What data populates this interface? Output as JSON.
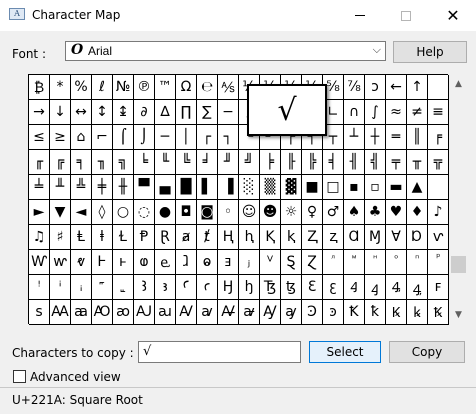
{
  "window": {
    "title": "Character Map",
    "app_icon_glyph": "A"
  },
  "font": {
    "label": "Font :",
    "selected": "Arial",
    "font_icon": "O",
    "help_label": "Help"
  },
  "grid_rows": [
    [
      "₿",
      "*",
      "%",
      "ℓ",
      "№",
      "℗",
      "™",
      "Ω",
      "℮",
      "⅍",
      "⅓",
      "⅓",
      "⅓",
      "⅓",
      "⅝",
      "⅞",
      "ↄ",
      "←",
      "↑",
      ""
    ],
    [
      "→",
      "↓",
      "↔",
      "↕",
      "↨",
      "∂",
      "∆",
      "∏",
      "∑",
      "−",
      "∕",
      "∙",
      "√",
      "∞",
      "∟",
      "∩",
      "∫",
      "≈",
      "≠",
      "≡"
    ],
    [
      "≤",
      "≥",
      "⌂",
      "⌐",
      "⌠",
      "⌡",
      "─",
      "│",
      "┌",
      "┐",
      "└",
      "┘",
      "├",
      "┤",
      "┬",
      "┴",
      "┼",
      "═",
      "║",
      "╒"
    ],
    [
      "╓",
      "╔",
      "╕",
      "╖",
      "╗",
      "╘",
      "╙",
      "╚",
      "╛",
      "╜",
      "╝",
      "╞",
      "╟",
      "╠",
      "╡",
      "╢",
      "╣",
      "╤",
      "╥",
      "╦"
    ],
    [
      "╧",
      "╨",
      "╩",
      "╪",
      "╫",
      "▀",
      "▄",
      "█",
      "▌",
      "▐",
      "░",
      "▒",
      "▓",
      "■",
      "□",
      "▪",
      "▫",
      "▬",
      "▲",
      ""
    ],
    [
      "►",
      "▼",
      "◄",
      "◊",
      "○",
      "◌",
      "●",
      "◘",
      "◙",
      "◦",
      "☺",
      "☻",
      "☼",
      "♀",
      "♂",
      "♠",
      "♣",
      "♥",
      "♦",
      "♪"
    ],
    [
      "♫",
      "♯",
      "Ⱡ",
      "ⱡ",
      "Ɫ",
      "Ᵽ",
      "Ɽ",
      "ⱥ",
      "ⱦ",
      "Ⱨ",
      "ⱨ",
      "Ⱪ",
      "ⱪ",
      "Ⱬ",
      "ⱬ",
      "Ɑ",
      "Ɱ",
      "Ɐ",
      "Ɒ",
      "ⱱ"
    ],
    [
      "Ⱳ",
      "ⱳ",
      "ⱴ",
      "Ⱶ",
      "ⱶ",
      "ⱷ",
      "ⱸ",
      "ⱹ",
      "ⱺ",
      "ⱻ",
      "ⱼ",
      "ⱽ",
      "Ȿ",
      "Ɀ",
      "ⷧ",
      "ⷨ",
      "ⷩ",
      "ⷪ",
      "ⷫ",
      "ⷬ"
    ],
    [
      "ꜝ",
      "ꜞ",
      "ꜟ",
      "꜠",
      "꜡",
      "Ꜣ",
      "ꜣ",
      "Ꜥ",
      "ꜥ",
      "Ꜧ",
      "ꜧ",
      "Ꜩ",
      "ꜩ",
      "Ꜫ",
      "ꜫ",
      "Ꜭ",
      "ꜭ",
      "Ꜯ",
      "ꜯ",
      "ꜰ"
    ],
    [
      "ꜱ",
      "Ꜳ",
      "ꜳ",
      "Ꜵ",
      "ꜵ",
      "Ꜷ",
      "ꜷ",
      "Ꜹ",
      "ꜹ",
      "Ꜻ",
      "ꜻ",
      "Ꜽ",
      "ꜽ",
      "Ꜿ",
      "ꜿ",
      "Ꝁ",
      "ꝁ",
      "Ꝃ",
      "ꝃ",
      "Ꝅ"
    ]
  ],
  "magnified_char": "√",
  "copy": {
    "label": "Characters to copy :",
    "value": "√",
    "select_label": "Select",
    "copy_label": "Copy"
  },
  "advanced": {
    "label": "Advanced view",
    "checked": false
  },
  "status": "U+221A: Square Root"
}
